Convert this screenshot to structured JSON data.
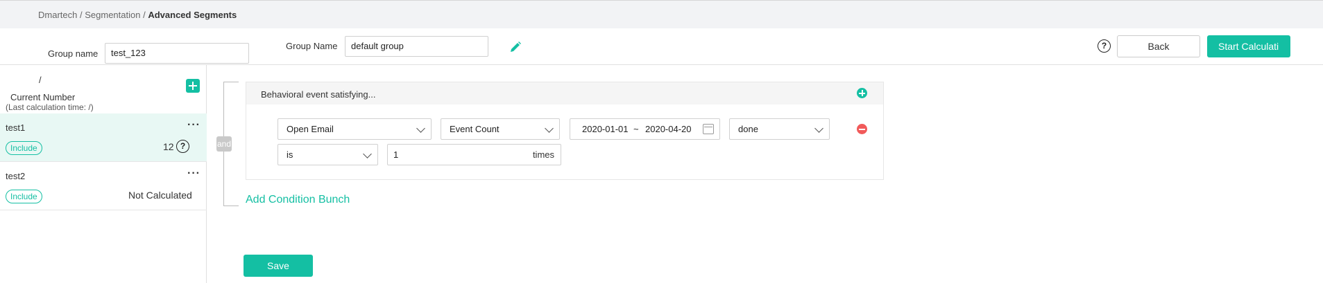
{
  "breadcrumb": {
    "items": [
      "Dmartech",
      "Segmentation"
    ],
    "separator": "/",
    "current": "Advanced Segments"
  },
  "header": {
    "group_name_label": "Group name",
    "group_name_value": "test_123",
    "group_name2_label": "Group Name",
    "group_name2_value": "default group",
    "help_icon": "?",
    "back_label": "Back",
    "start_label": "Start Calculati"
  },
  "sidebar": {
    "slash": "/",
    "current_number": "Current Number",
    "last_calc": "(Last calculation time: /)",
    "groups": [
      {
        "name": "test1",
        "badge": "Include",
        "count": "12",
        "more": "···",
        "help": "?"
      },
      {
        "name": "test2",
        "badge": "Include",
        "count": "Not Calculated",
        "more": "···"
      }
    ]
  },
  "condition": {
    "and_label": "and",
    "title": "Behavioral event satisfying...",
    "event": "Open Email",
    "metric": "Event Count",
    "date_from": "2020-01-01",
    "date_sep": "~",
    "date_to": "2020-04-20",
    "status": "done",
    "operator": "is",
    "value": "1",
    "unit": "times"
  },
  "actions": {
    "add_bunch": "Add Condition Bunch",
    "save": "Save"
  },
  "colors": {
    "accent": "#14bfa3",
    "danger": "#f15a5a",
    "breadcrumb_bg": "#f2f3f5"
  },
  "icons": [
    "pencil-icon",
    "help-icon",
    "add-group-icon",
    "more-icon",
    "add-condition-icon",
    "remove-condition-icon",
    "calendar-icon",
    "chevron-down-icon"
  ]
}
